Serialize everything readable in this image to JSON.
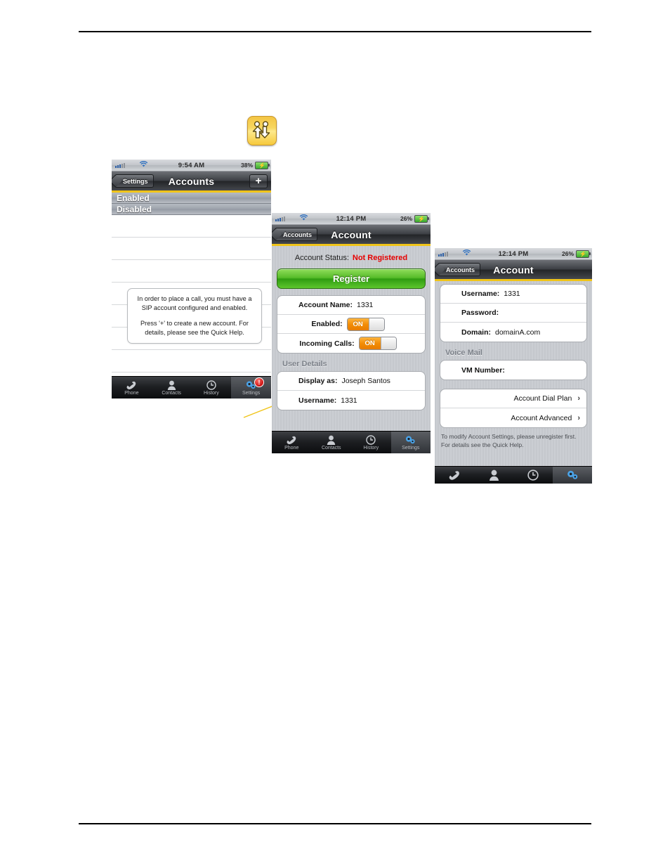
{
  "transfer_icon": {
    "name": "transfer-call-icon",
    "color": "#f4c544"
  },
  "screen1": {
    "statusbar": {
      "time": "9:54 AM",
      "battery": "38%",
      "wifi_icon": "wifi-icon",
      "signal_icon": "signal-bars-icon"
    },
    "navbar": {
      "back_label": "Settings",
      "title": "Accounts",
      "add_label": "+"
    },
    "sections": [
      {
        "label": "Enabled"
      },
      {
        "label": "Disabled"
      }
    ],
    "callout": {
      "line1": "In order to place a call, you must have a SIP account configured and enabled.",
      "line2": "Press '+' to create a new account. For details, please see the Quick Help."
    },
    "tabs": [
      {
        "label": "Phone",
        "icon": "phone-handset-icon",
        "active": false
      },
      {
        "label": "Contacts",
        "icon": "person-icon",
        "active": false
      },
      {
        "label": "History",
        "icon": "clock-icon",
        "active": false
      },
      {
        "label": "Settings",
        "icon": "gears-icon",
        "active": true,
        "badge": "!"
      }
    ]
  },
  "screen2": {
    "statusbar": {
      "time": "12:14 PM",
      "battery": "26%",
      "wifi_icon": "wifi-icon",
      "signal_icon": "signal-bars-icon"
    },
    "navbar": {
      "back_label": "Accounts",
      "title": "Account"
    },
    "account_status": {
      "label": "Account Status:",
      "value": "Not Registered"
    },
    "register_button": "Register",
    "fields": [
      {
        "label": "Account Name:",
        "value": "1331",
        "type": "text"
      },
      {
        "label": "Enabled:",
        "value": "ON",
        "type": "toggle"
      },
      {
        "label": "Incoming Calls:",
        "value": "ON",
        "type": "toggle"
      }
    ],
    "user_details_header": "User Details",
    "user_fields": [
      {
        "label": "Display as:",
        "value": "Joseph Santos"
      },
      {
        "label": "Username:",
        "value": "1331"
      }
    ],
    "tabs": [
      {
        "label": "Phone",
        "icon": "phone-handset-icon",
        "active": false
      },
      {
        "label": "Contacts",
        "icon": "person-icon",
        "active": false
      },
      {
        "label": "History",
        "icon": "clock-icon",
        "active": false
      },
      {
        "label": "Settings",
        "icon": "gears-icon",
        "active": true
      }
    ]
  },
  "screen3": {
    "statusbar": {
      "time": "12:14 PM",
      "battery": "26%",
      "wifi_icon": "wifi-icon",
      "signal_icon": "signal-bars-icon"
    },
    "navbar": {
      "back_label": "Accounts",
      "title": "Account"
    },
    "fields": [
      {
        "label": "Username:",
        "value": "1331"
      },
      {
        "label": "Password:",
        "value": ""
      },
      {
        "label": "Domain:",
        "value": "domainA.com"
      }
    ],
    "voicemail_header": "Voice Mail",
    "voicemail_fields": [
      {
        "label": "VM Number:",
        "value": ""
      }
    ],
    "links": [
      {
        "label": "Account Dial Plan",
        "chevron": "chevron-right-icon"
      },
      {
        "label": "Account Advanced",
        "chevron": "chevron-right-icon"
      }
    ],
    "footnote": {
      "line1": "To modify Account Settings, please unregister first.",
      "line2": "For details see the Quick Help."
    },
    "tabs": [
      {
        "label": "",
        "icon": "phone-handset-icon",
        "active": false
      },
      {
        "label": "",
        "icon": "person-icon",
        "active": false
      },
      {
        "label": "",
        "icon": "clock-icon",
        "active": false
      },
      {
        "label": "",
        "icon": "gears-icon",
        "active": true
      }
    ]
  }
}
